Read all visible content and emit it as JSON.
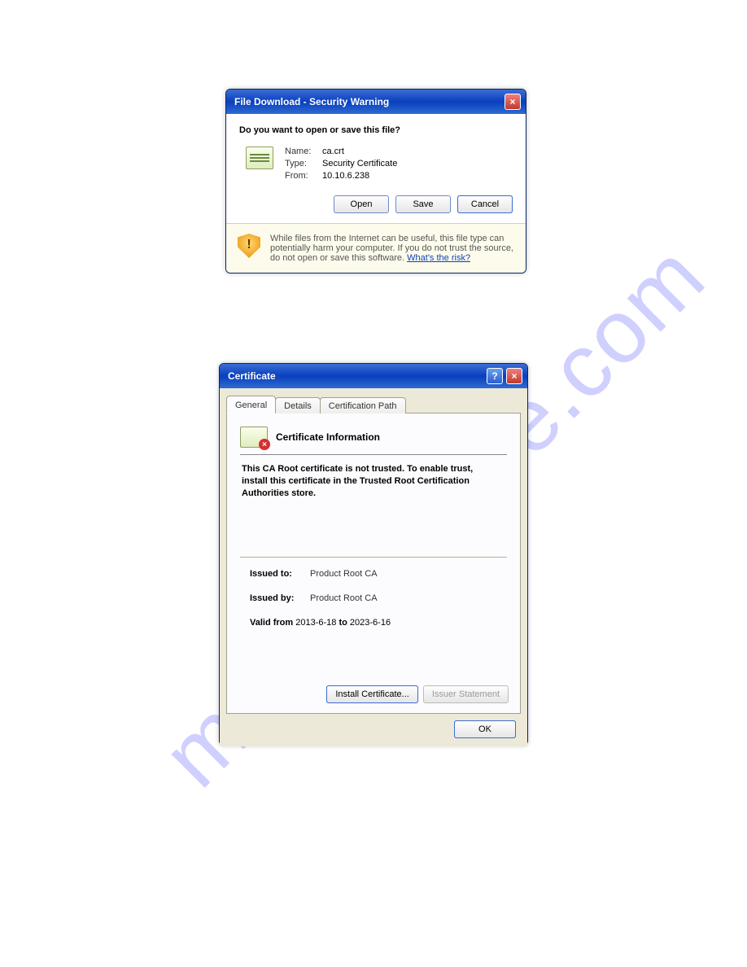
{
  "watermark": "manualshive.com",
  "dialog1": {
    "title": "File Download - Security Warning",
    "question": "Do you want to open or save this file?",
    "labels": {
      "name": "Name:",
      "type": "Type:",
      "from": "From:"
    },
    "values": {
      "name": "ca.crt",
      "type": "Security Certificate",
      "from": "10.10.6.238"
    },
    "buttons": {
      "open": "Open",
      "save": "Save",
      "cancel": "Cancel"
    },
    "warning_text_pre": "While files from the Internet can be useful, this file type can potentially harm your computer. If you do not trust the source, do not open or save this software. ",
    "warning_link": "What's the risk?"
  },
  "dialog2": {
    "title": "Certificate",
    "tabs": {
      "general": "General",
      "details": "Details",
      "path": "Certification Path"
    },
    "cert_info_title": "Certificate Information",
    "cert_msg": "This CA Root certificate is not trusted. To enable trust, install this certificate in the Trusted Root Certification Authorities store.",
    "issued_to_label": "Issued to:",
    "issued_to_value": "Product Root CA",
    "issued_by_label": "Issued by:",
    "issued_by_value": "Product Root CA",
    "valid_from_label": "Valid from",
    "valid_from_value": "2013-6-18",
    "valid_to_label": "to",
    "valid_to_value": "2023-6-16",
    "install_btn": "Install Certificate...",
    "issuer_btn": "Issuer Statement",
    "ok_btn": "OK"
  }
}
